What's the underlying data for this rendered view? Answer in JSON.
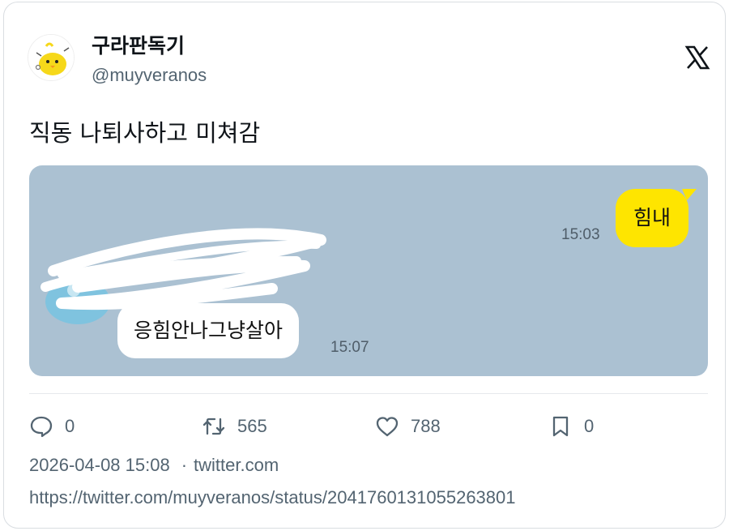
{
  "author": {
    "display_name": "구라판독기",
    "handle": "@muyveranos",
    "avatar_icon": "yellow-chick-avatar"
  },
  "platform": {
    "logo_icon": "x-logo-icon"
  },
  "tweet": {
    "text": "직동 나퇴사하고 미쳐감"
  },
  "chat_image": {
    "background": "#abc1d2",
    "messages": [
      {
        "side": "right",
        "text": "힘내",
        "time": "15:03",
        "bubble_color": "#fee500"
      },
      {
        "side": "left",
        "text": "응힘안나그냥살아",
        "time": "15:07",
        "bubble_color": "#ffffff"
      }
    ]
  },
  "actions": {
    "reply": {
      "icon": "reply-bubble-icon",
      "count": "0"
    },
    "retweet": {
      "icon": "retweet-icon",
      "count": "565"
    },
    "like": {
      "icon": "heart-icon",
      "count": "788"
    },
    "bookmark": {
      "icon": "bookmark-icon",
      "count": "0"
    }
  },
  "meta": {
    "timestamp": "2026-04-08 15:08",
    "separator": "·",
    "source": "twitter.com"
  },
  "url": "https://twitter.com/muyveranos/status/2041760131055263801"
}
